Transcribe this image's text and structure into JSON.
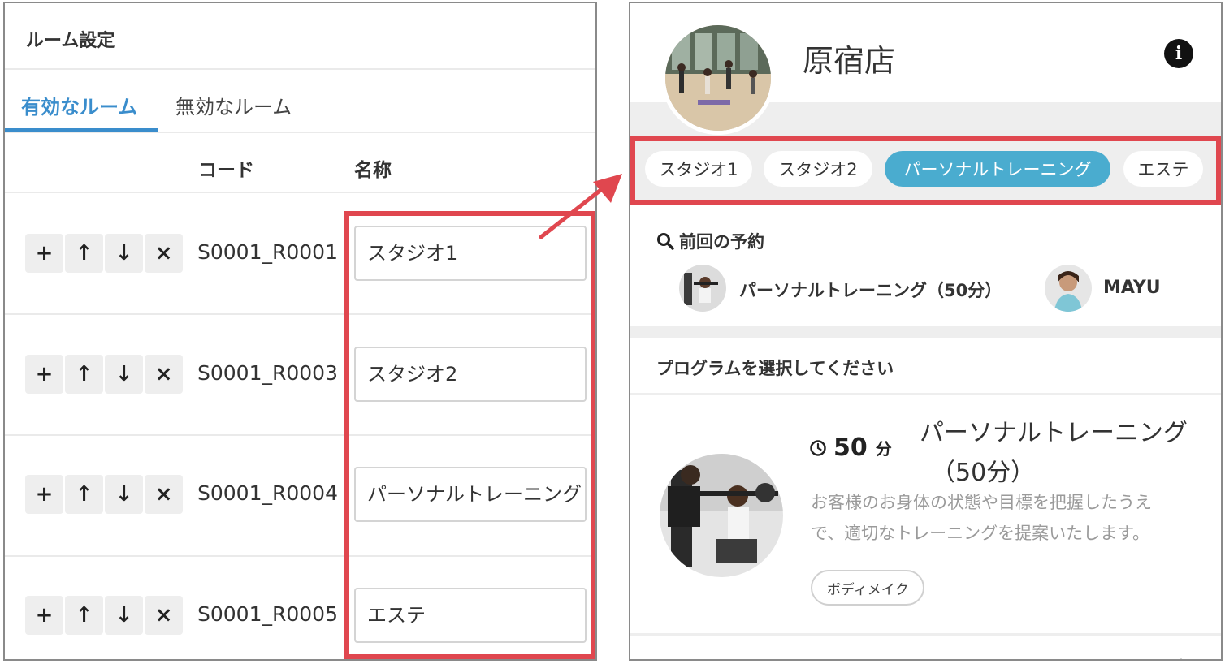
{
  "left": {
    "title": "ルーム設定",
    "tabs": [
      {
        "label": "有効なルーム",
        "active": true
      },
      {
        "label": "無効なルーム",
        "active": false
      }
    ],
    "columns": {
      "code": "コード",
      "name": "名称"
    },
    "row_buttons": {
      "add": "+",
      "up": "↑",
      "down": "↓",
      "delete": "×"
    },
    "rooms": [
      {
        "code": "S0001_R0001",
        "name": "スタジオ1"
      },
      {
        "code": "S0001_R0003",
        "name": "スタジオ2"
      },
      {
        "code": "S0001_R0004",
        "name": "パーソナルトレーニング"
      },
      {
        "code": "S0001_R0005",
        "name": "エステ"
      }
    ]
  },
  "right": {
    "store_name": "原宿店",
    "info_icon": "i",
    "room_pills": [
      {
        "label": "スタジオ1",
        "active": false
      },
      {
        "label": "スタジオ2",
        "active": false
      },
      {
        "label": "パーソナルトレーニング",
        "active": true
      },
      {
        "label": "エステ",
        "active": false
      }
    ],
    "previous": {
      "heading": "前回の予約",
      "program": "パーソナルトレーニング（50分）",
      "staff": "MAYU"
    },
    "select_heading": "プログラムを選択してください",
    "program": {
      "duration": "50",
      "duration_unit": "分",
      "title_line1": "パーソナルトレーニング",
      "title_line2": "（50分）",
      "description": "お客様のお身体の状態や目標を把握したうえで、適切なトレーニングを提案いたします。",
      "tag": "ボディメイク"
    },
    "next_program_title": "パーソナルトレーニング"
  },
  "colors": {
    "accent_blue": "#3a8dcc",
    "pill_active": "#4aaccf",
    "highlight_red": "#e0474f"
  }
}
